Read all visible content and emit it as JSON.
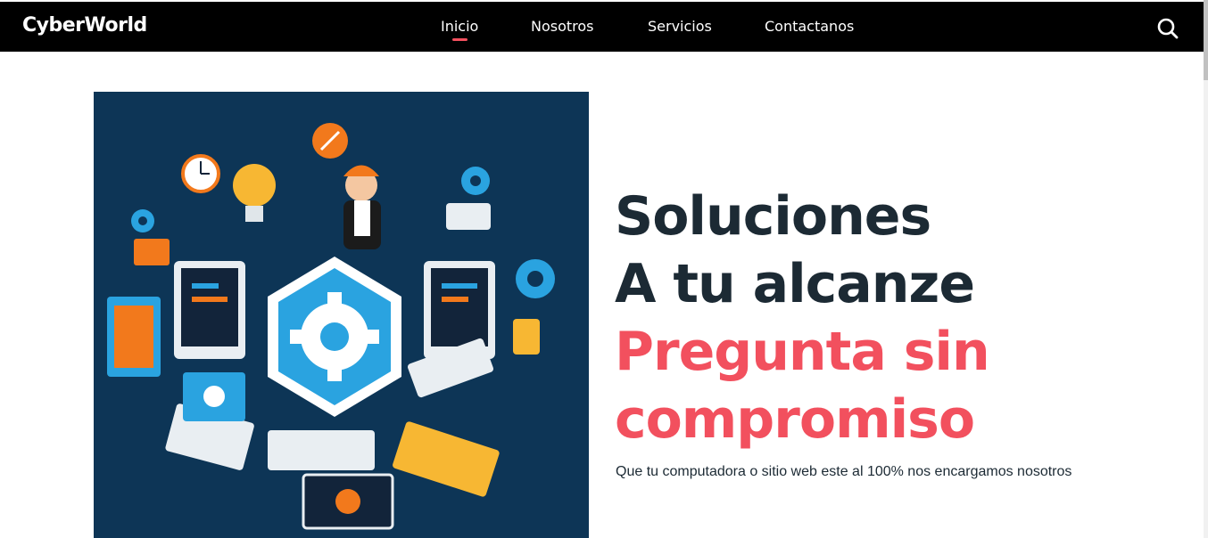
{
  "header": {
    "brand": "CyberWorld",
    "nav": [
      {
        "label": "Inicio",
        "active": true
      },
      {
        "label": "Nosotros",
        "active": false
      },
      {
        "label": "Servicios",
        "active": false
      },
      {
        "label": "Contactanos",
        "active": false
      }
    ],
    "search_icon": "search-icon"
  },
  "hero": {
    "line1": "Soluciones",
    "line2": "A tu alcanze",
    "line3": "Pregunta sin",
    "line4": "compromiso",
    "subtitle": "Que tu computadora o sitio web este al 100% nos encargamos nosotros",
    "illustration": "tech-support-illustration"
  },
  "colors": {
    "nav_bg": "#000000",
    "accent": "#f2505e",
    "heading": "#1c2a34",
    "illustration_bg": "#0d3556"
  }
}
